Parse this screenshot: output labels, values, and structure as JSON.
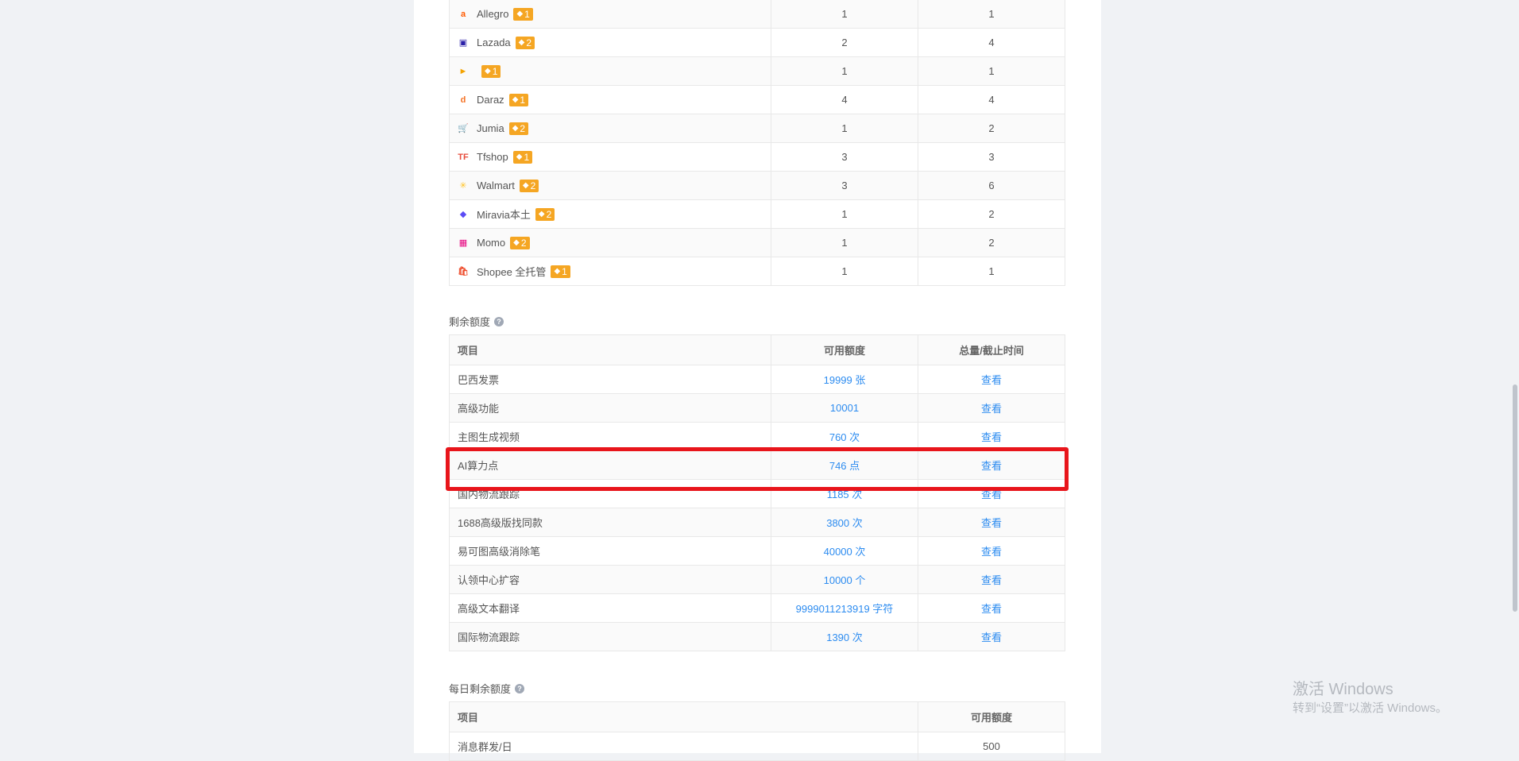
{
  "platforms": {
    "rows": [
      {
        "name": "Allegro",
        "icon": "allegro-icon",
        "glyph": "a",
        "color": "#ff5a00",
        "badge": "1",
        "col2": "1",
        "col3": "1"
      },
      {
        "name": "Lazada",
        "icon": "lazada-icon",
        "glyph": "▣",
        "color": "#2a1fa8",
        "badge": "2",
        "col2": "2",
        "col3": "4"
      },
      {
        "name": "",
        "icon": "flag-icon",
        "glyph": "►",
        "color": "#f4a300",
        "badge": "1",
        "col2": "1",
        "col3": "1"
      },
      {
        "name": "Daraz",
        "icon": "daraz-icon",
        "glyph": "d",
        "color": "#f57224",
        "badge": "1",
        "col2": "4",
        "col3": "4"
      },
      {
        "name": "Jumia",
        "icon": "cart-icon",
        "glyph": "🛒",
        "color": "#f68b1e",
        "badge": "2",
        "col2": "1",
        "col3": "2"
      },
      {
        "name": "Tfshop",
        "icon": "tfshop-icon",
        "glyph": "TF",
        "color": "#e74c3c",
        "badge": "1",
        "col2": "3",
        "col3": "3"
      },
      {
        "name": "Walmart",
        "icon": "walmart-spark-icon",
        "glyph": "✳",
        "color": "#ffc220",
        "badge": "2",
        "col2": "3",
        "col3": "6"
      },
      {
        "name": "Miravia本土",
        "icon": "miravia-icon",
        "glyph": "◆",
        "color": "#5b4cf5",
        "badge": "2",
        "col2": "1",
        "col3": "2"
      },
      {
        "name": "Momo",
        "icon": "momo-icon",
        "glyph": "▦",
        "color": "#e6007e",
        "badge": "2",
        "col2": "1",
        "col3": "2"
      },
      {
        "name": "Shopee 全托管",
        "icon": "shopee-icon",
        "glyph": "🛍",
        "color": "#ee4d2d",
        "badge": "1",
        "col2": "1",
        "col3": "1"
      }
    ]
  },
  "remaining": {
    "title": "剩余额度",
    "headers": [
      "项目",
      "可用额度",
      "总量/截止时间"
    ],
    "rows": [
      {
        "item": "巴西发票",
        "amount": "19999 张",
        "action": "查看"
      },
      {
        "item": "高级功能",
        "amount": "10001",
        "action": "查看"
      },
      {
        "item": "主图生成视频",
        "amount": "760 次",
        "action": "查看"
      },
      {
        "item": "AI算力点",
        "amount": "746 点",
        "action": "查看"
      },
      {
        "item": "国内物流跟踪",
        "amount": "1185 次",
        "action": "查看"
      },
      {
        "item": "1688高级版找同款",
        "amount": "3800 次",
        "action": "查看"
      },
      {
        "item": "易可图高级消除笔",
        "amount": "40000 次",
        "action": "查看"
      },
      {
        "item": "认领中心扩容",
        "amount": "10000 个",
        "action": "查看"
      },
      {
        "item": "高级文本翻译",
        "amount": "9999011213919 字符",
        "action": "查看"
      },
      {
        "item": "国际物流跟踪",
        "amount": "1390 次",
        "action": "查看"
      }
    ]
  },
  "daily": {
    "title": "每日剩余额度",
    "headers": [
      "项目",
      "可用额度"
    ],
    "rows": [
      {
        "item": "消息群发/日",
        "amount": "500"
      }
    ]
  },
  "watermark": {
    "line1": "激活 Windows",
    "line2": "转到“设置”以激活 Windows。"
  },
  "colors": {
    "accent": "#2d8cf0",
    "badge": "#f5a623",
    "highlight": "#e8151b"
  }
}
